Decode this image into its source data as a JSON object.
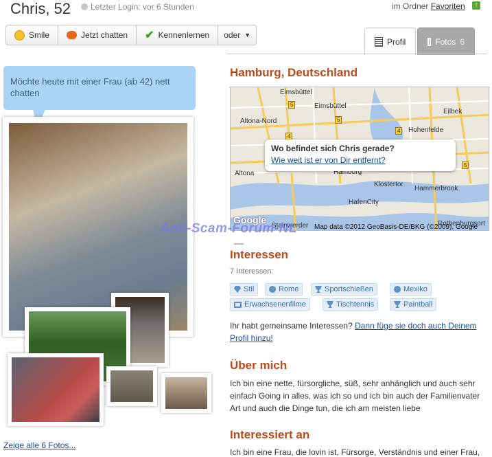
{
  "header": {
    "name": "Chris, 52",
    "last_login": "Letzter Login: vor 6 Stunden",
    "folder_prefix": "im Ordner ",
    "folder_link": "Favoriten"
  },
  "actions": [
    {
      "label": "Smile",
      "icon": "smile-icon"
    },
    {
      "label": "Jetzt chatten",
      "icon": "chat-icon"
    },
    {
      "label": "Kennenlernen",
      "icon": "checkmark-icon"
    },
    {
      "label": "oder",
      "icon": "dropdown-arrow-icon"
    }
  ],
  "tabs": {
    "profil": "Profil",
    "fotos": "Fotos",
    "fotos_count": "6"
  },
  "status_message": "Möchte heute mit einer Frau (ab 42) nett chatten",
  "photos_link": "Zeige alle 6 Fotos...",
  "location": {
    "title": "Hamburg, Deutschland",
    "popup_question": "Wo befindet sich Chris gerade?",
    "popup_link": "Wie weit ist er von Dir entfernt?",
    "labels": [
      "Eimsbüttel",
      "Eimsbüttel",
      "Altona-Nord",
      "Hohenfelde",
      "Eilbek",
      "Altona",
      "Hamburg",
      "Klostertor",
      "Hammerbrook",
      "HafenCity",
      "Steinwerder",
      "Rothenburgsort"
    ],
    "road_numbers": [
      "5",
      "5",
      "4",
      "5",
      "4"
    ],
    "google": "Google",
    "copyright": "Map data ©2012 GeoBasis-DE/BKG (©2009), Google"
  },
  "watermark": "Anti-Scam-Forum-NL",
  "interests": {
    "title": "Interessen",
    "count": "7 Interessen:",
    "items": [
      {
        "label": "Stil",
        "icon": "diamond-icon"
      },
      {
        "label": "Rome",
        "icon": "globe-icon"
      },
      {
        "label": "Sportschießen",
        "icon": "trophy-icon"
      },
      {
        "label": "Mexiko",
        "icon": "globe-icon"
      },
      {
        "label": "Erwachsenenfilme",
        "icon": "tv-icon"
      },
      {
        "label": "Tischtennis",
        "icon": "trophy-icon"
      },
      {
        "label": "Paintball",
        "icon": "trophy-icon"
      }
    ],
    "shared_text": "Ihr habt gemeinsame Interessen? ",
    "shared_link": "Dann füge sie doch auch Deinem Profil hinzu!"
  },
  "about": {
    "title": "Über mich",
    "text": "Ich bin eine nette, fürsorgliche, süß, sehr anhänglich und auch sehr einfach Going in alles, was ich so und ich bin auch der Familienvater Art und auch die Dinge tun, die ich am meisten liebe"
  },
  "interested_in": {
    "title": "Interessiert an",
    "text": "Ich bin eine Frau, die lovin ist, Fürsorge, Verständnis und einer Frau,"
  }
}
